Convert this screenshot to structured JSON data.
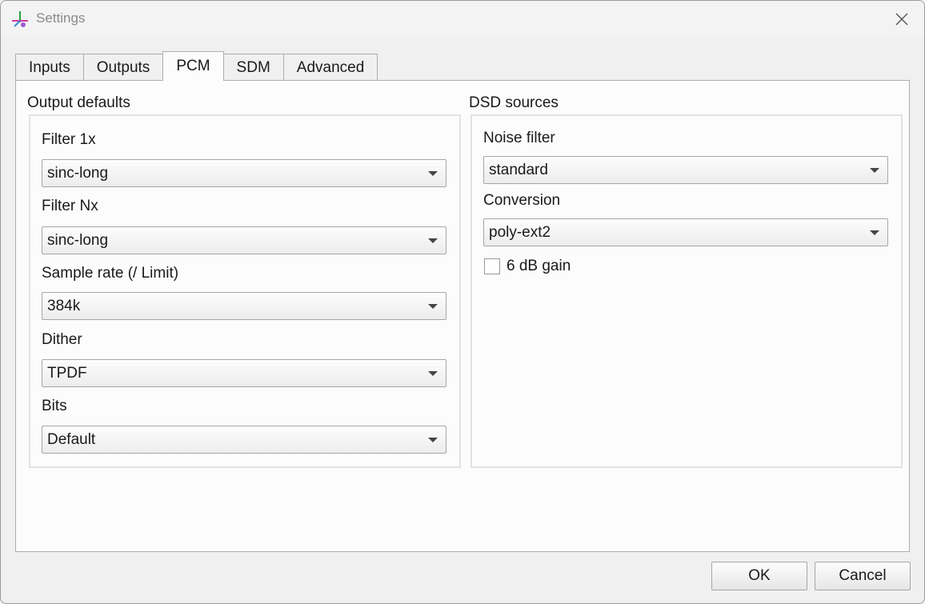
{
  "window": {
    "title": "Settings",
    "icons": {
      "app": "app-icon",
      "close": "close-icon"
    }
  },
  "tabs": [
    {
      "label": "Inputs",
      "active": false
    },
    {
      "label": "Outputs",
      "active": false
    },
    {
      "label": "PCM",
      "active": true
    },
    {
      "label": "SDM",
      "active": false
    },
    {
      "label": "Advanced",
      "active": false
    }
  ],
  "output_defaults": {
    "title": "Output defaults",
    "filter_1x": {
      "label": "Filter 1x",
      "value": "sinc-long"
    },
    "filter_nx": {
      "label": "Filter Nx",
      "value": "sinc-long"
    },
    "sample_rate": {
      "label": "Sample rate (/ Limit)",
      "value": "384k"
    },
    "dither": {
      "label": "Dither",
      "value": "TPDF"
    },
    "bits": {
      "label": "Bits",
      "value": "Default"
    }
  },
  "dsd_sources": {
    "title": "DSD sources",
    "noise_filter": {
      "label": "Noise filter",
      "value": "standard"
    },
    "conversion": {
      "label": "Conversion",
      "value": "poly-ext2"
    },
    "gain": {
      "label": "6 dB gain",
      "checked": false
    }
  },
  "buttons": {
    "ok": "OK",
    "cancel": "Cancel"
  }
}
